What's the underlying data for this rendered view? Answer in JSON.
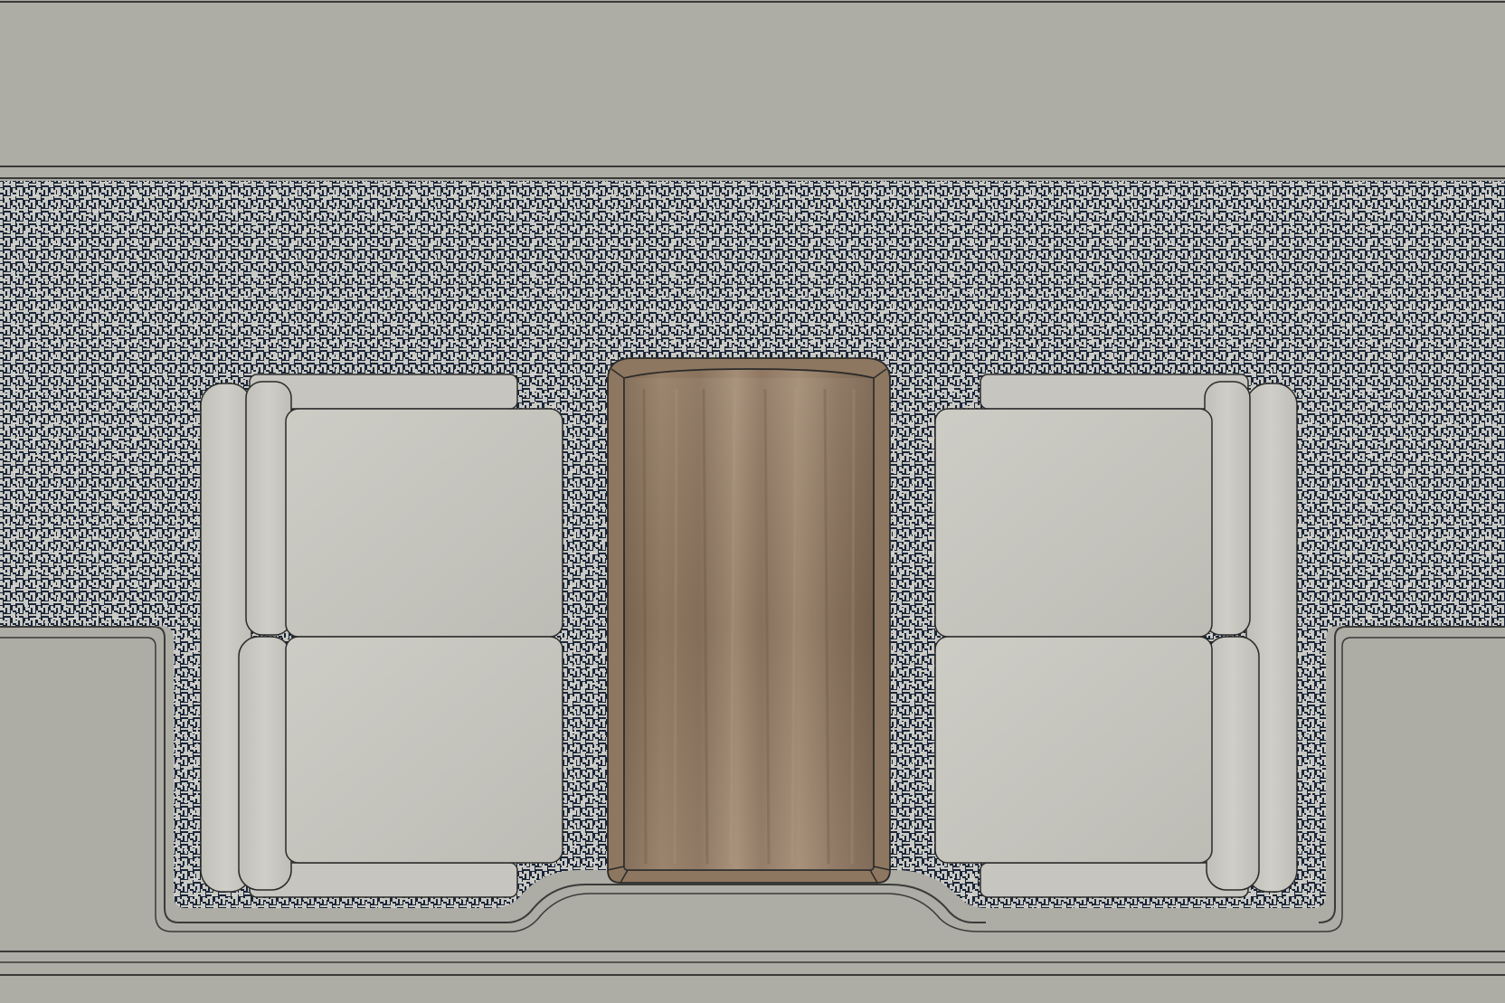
{
  "colors": {
    "wall": "#adaca5",
    "wall_edge": "#3a3a38",
    "carpet_dark": "#1a2538",
    "carpet_light": "#c9c9c4",
    "cushion": "#c3c2bb",
    "cushion_light": "#cfcec8",
    "arm": "#c7c6c0",
    "outline": "#2b2b2a",
    "wood_dark": "#7b6651",
    "wood_mid": "#957d65",
    "wood_light": "#a8917a"
  },
  "elements": {
    "rug": "carpet-rug",
    "table": "wood-table",
    "seat_left": "seat-left",
    "seat_right": "seat-right"
  }
}
